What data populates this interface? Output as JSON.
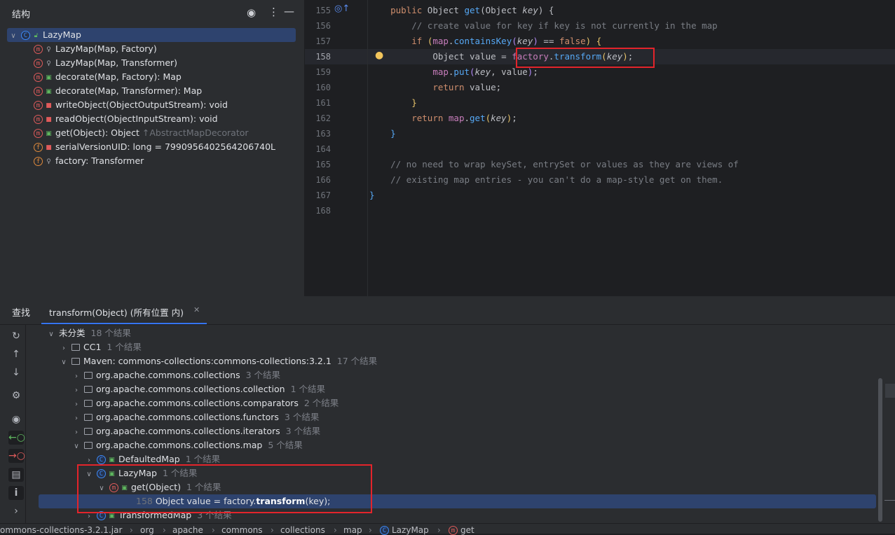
{
  "structure": {
    "title": "结构",
    "icons": [
      "eye-icon",
      "more-vertical-icon",
      "minimize-icon"
    ],
    "root": "LazyMap",
    "items": [
      {
        "kind": "m",
        "access": "key",
        "label": "LazyMap(Map, Factory)",
        "extra": ""
      },
      {
        "kind": "m",
        "access": "key",
        "label": "LazyMap(Map, Transformer)",
        "extra": ""
      },
      {
        "kind": "m",
        "access": "open",
        "label": "decorate(Map, Factory): Map",
        "extra": ""
      },
      {
        "kind": "m",
        "access": "open",
        "label": "decorate(Map, Transformer): Map",
        "extra": ""
      },
      {
        "kind": "m",
        "access": "lock",
        "label": "writeObject(ObjectOutputStream): void",
        "extra": ""
      },
      {
        "kind": "m",
        "access": "lock",
        "label": "readObject(ObjectInputStream): void",
        "extra": ""
      },
      {
        "kind": "m",
        "access": "open",
        "label": "get(Object): Object",
        "extra": "↑AbstractMapDecorator"
      },
      {
        "kind": "f",
        "access": "lock",
        "label": "serialVersionUID: long = 7990956402564206740L",
        "extra": ""
      },
      {
        "kind": "f",
        "access": "key",
        "label": "factory: Transformer",
        "extra": ""
      }
    ]
  },
  "editor": {
    "line_numbers": [
      "155",
      "156",
      "157",
      "158",
      "159",
      "160",
      "161",
      "162",
      "163",
      "164",
      "165",
      "166",
      "167",
      "168"
    ],
    "current_line": "158",
    "comment1": "// create value for key if key is not currently in the map",
    "comment2": "// no need to wrap keySet, entrySet or values as they are views of",
    "comment3": "// existing map entries - you can't do a map-style get on them."
  },
  "find": {
    "tool_label": "查找",
    "tab_label": "transform(Object) (所有位置 内)",
    "rows": {
      "uncat": {
        "label": "未分类",
        "count": "18 个结果"
      },
      "cc1": {
        "label": "CC1",
        "count": "1 个结果"
      },
      "maven": {
        "label": "Maven: commons-collections:commons-collections:3.2.1",
        "count": "17 个结果"
      },
      "p1": {
        "label": "org.apache.commons.collections",
        "count": "3 个结果"
      },
      "p2": {
        "label": "org.apache.commons.collections.collection",
        "count": "1 个结果"
      },
      "p3": {
        "label": "org.apache.commons.collections.comparators",
        "count": "2 个结果"
      },
      "p4": {
        "label": "org.apache.commons.collections.functors",
        "count": "3 个结果"
      },
      "p5": {
        "label": "org.apache.commons.collections.iterators",
        "count": "3 个结果"
      },
      "p6": {
        "label": "org.apache.commons.collections.map",
        "count": "5 个结果"
      },
      "defaulted": {
        "label": "DefaultedMap",
        "count": "1 个结果"
      },
      "lazy": {
        "label": "LazyMap",
        "count": "1 个结果"
      },
      "getobj": {
        "label": "get(Object)",
        "count": "1 个结果"
      },
      "hit": {
        "line": "158",
        "before": "Object value = factory.",
        "match": "transform",
        "after": "(key);"
      },
      "transformed": {
        "label": "TransformedMap",
        "count": "3 个结果"
      }
    }
  },
  "breadcrumb": [
    "ommons-collections-3.2.1.jar",
    "org",
    "apache",
    "commons",
    "collections",
    "map",
    "LazyMap",
    "get"
  ]
}
